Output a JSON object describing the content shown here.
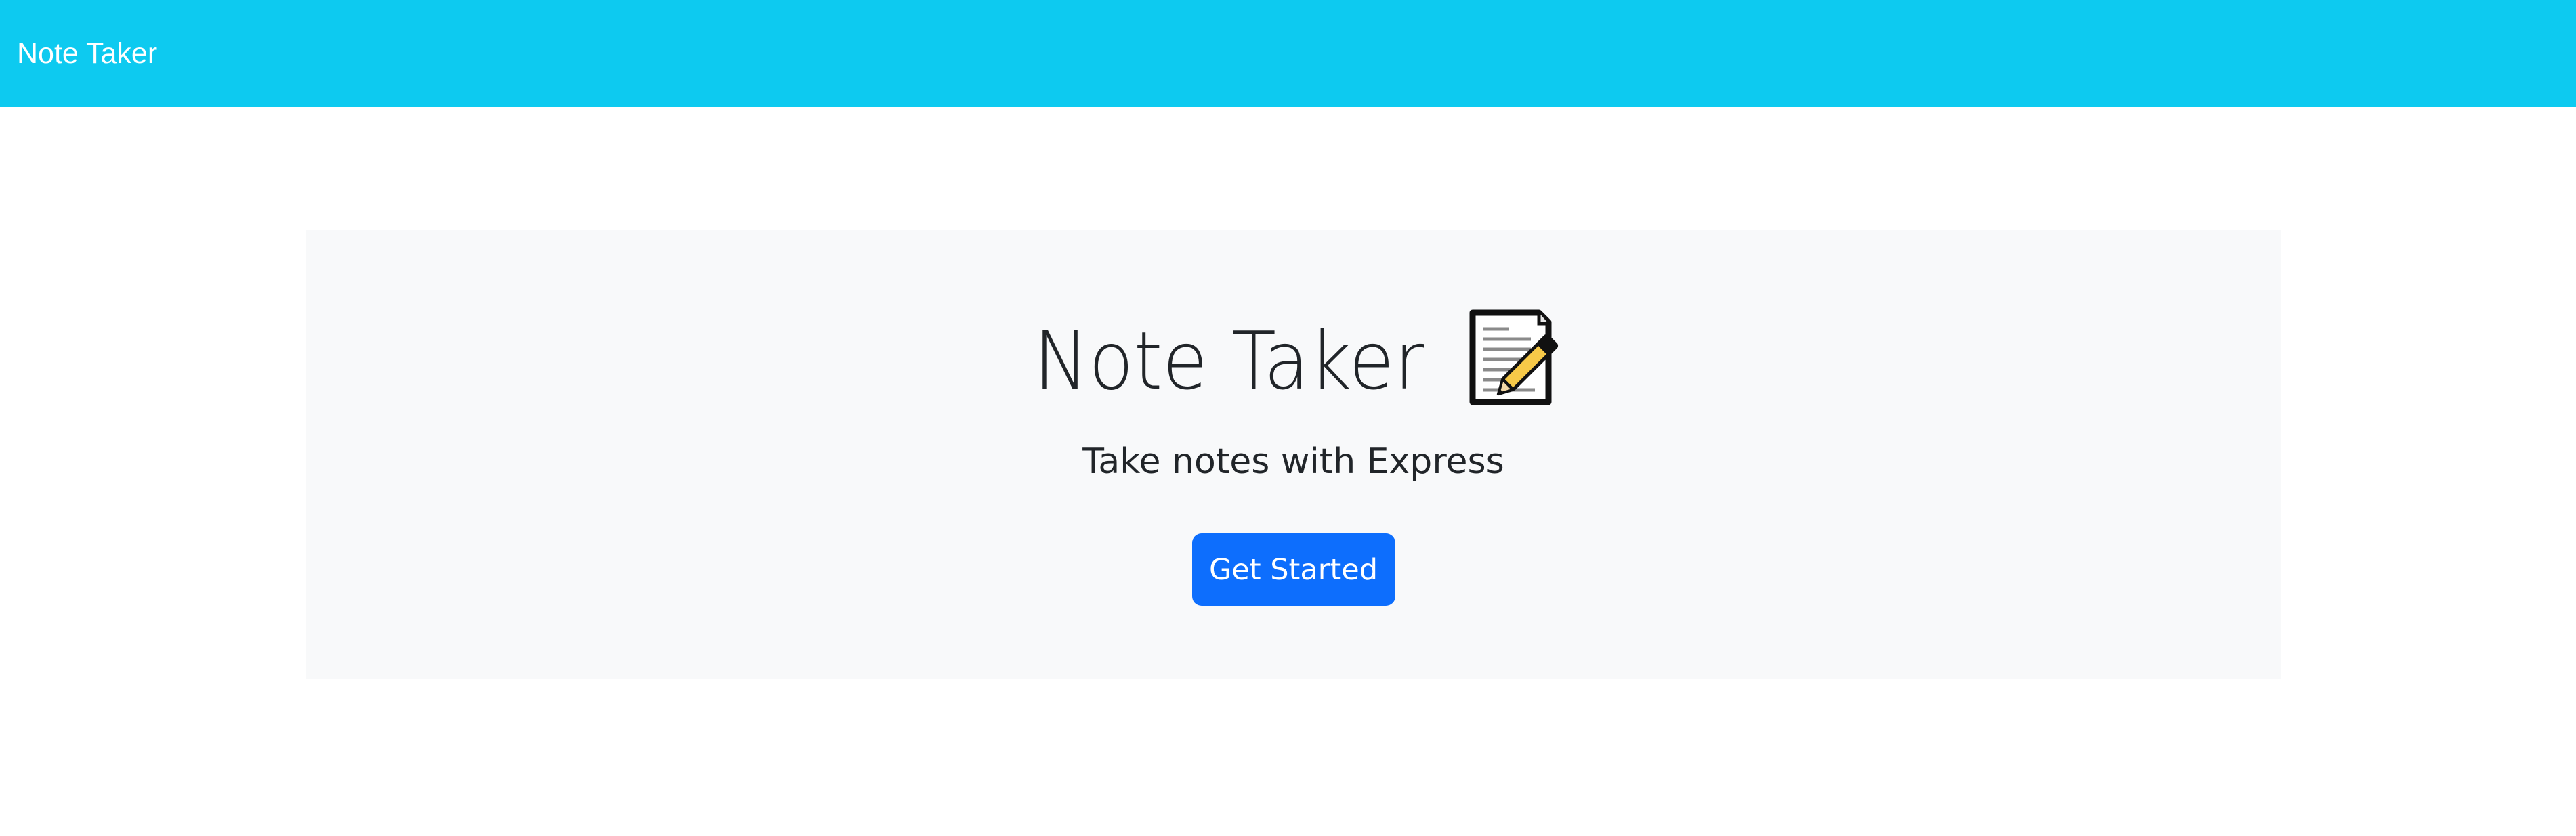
{
  "navbar": {
    "brand": "Note Taker",
    "background": "#0dcaf0"
  },
  "hero": {
    "title": "Note Taker",
    "title_icon": "memo-icon",
    "subtitle": "Take notes with Express",
    "cta_label": "Get Started",
    "cta_color": "#0d6efd",
    "background": "#f8f9fa"
  }
}
